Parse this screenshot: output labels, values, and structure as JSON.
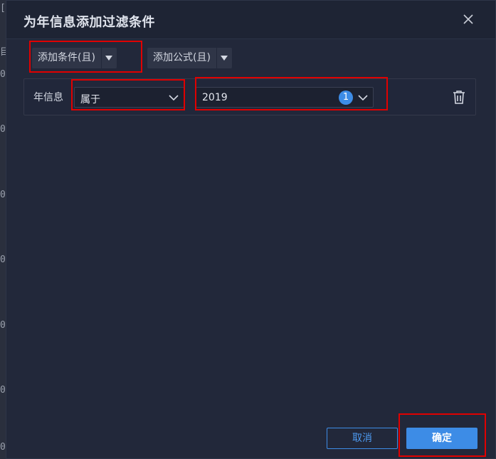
{
  "background_fragments": [
    "[",
    "目",
    "0",
    "0",
    "0",
    "0",
    "0",
    "0",
    "0"
  ],
  "dialog": {
    "title": "为年信息添加过滤条件",
    "close_icon": "close-icon"
  },
  "toolbar": {
    "add_condition_label": "添加条件(且)",
    "add_formula_label": "添加公式(且)"
  },
  "filter": {
    "field_label": "年信息",
    "operator": "属于",
    "value": "2019",
    "selected_count": "1"
  },
  "footer": {
    "cancel_label": "取消",
    "confirm_label": "确定"
  },
  "colors": {
    "accent": "#3d8ce6",
    "highlight": "#e00000",
    "dialog_bg": "#22283a"
  }
}
